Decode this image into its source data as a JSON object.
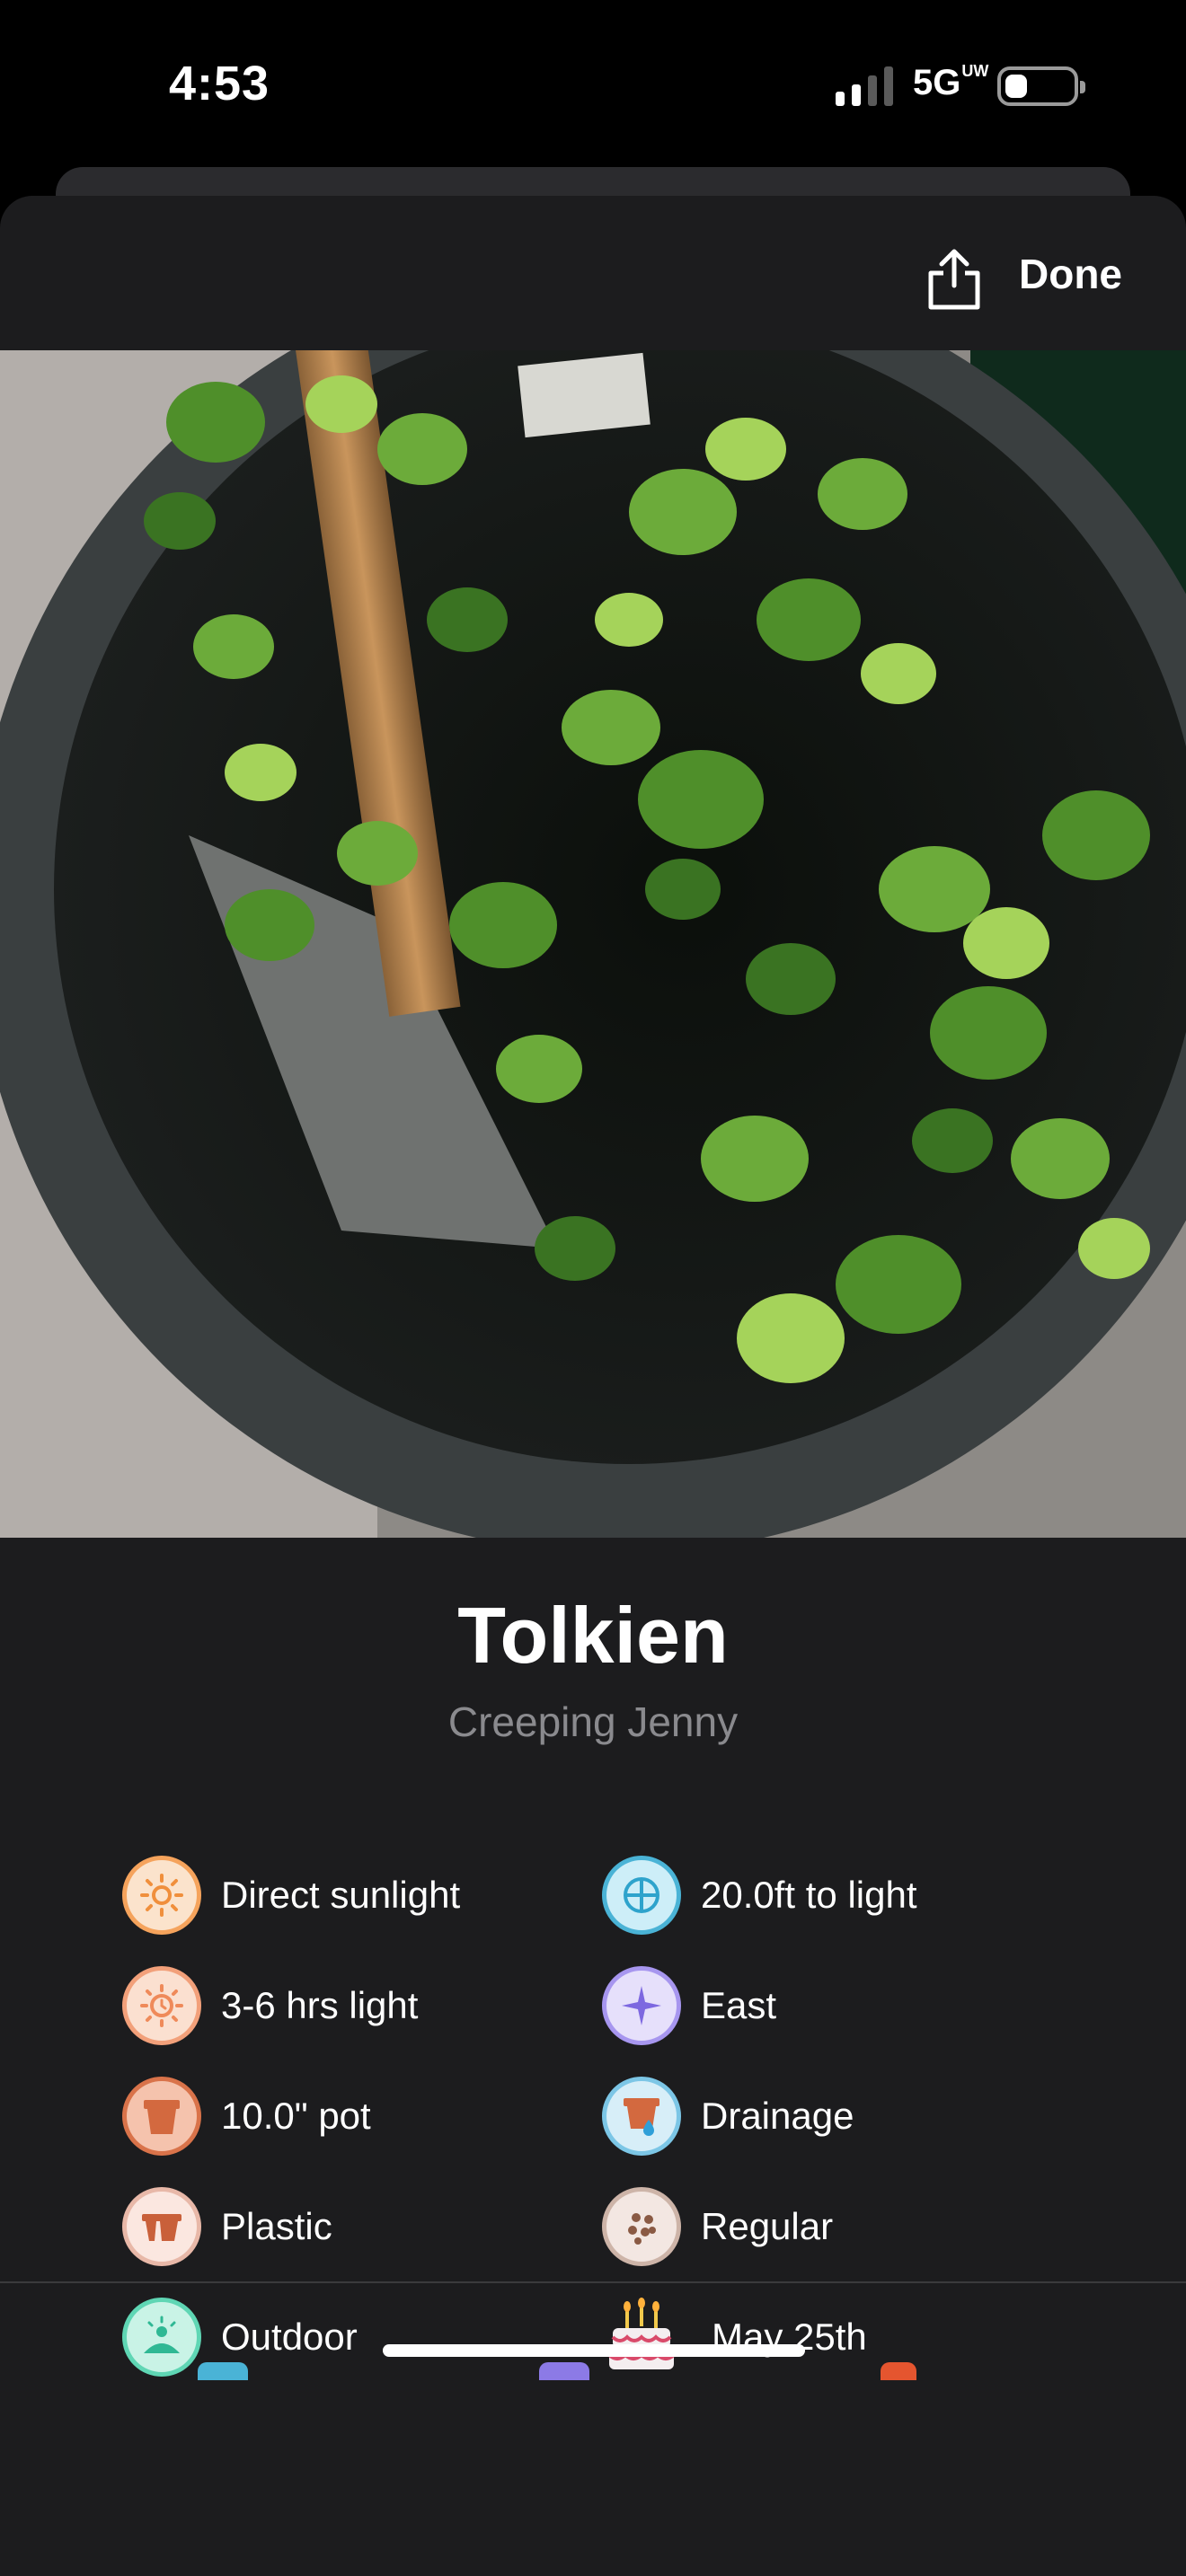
{
  "status_bar": {
    "time": "4:53",
    "network": "5G",
    "network_sup": "UW"
  },
  "header": {
    "done_label": "Done"
  },
  "plant": {
    "name": "Tolkien",
    "species": "Creeping Jenny"
  },
  "attributes_left": [
    {
      "icon": "sun-icon",
      "label": "Direct sunlight"
    },
    {
      "icon": "sun-clock-icon",
      "label": "3-6 hrs light"
    },
    {
      "icon": "pot-icon",
      "label": "10.0\" pot"
    },
    {
      "icon": "plastic-pot-icon",
      "label": "Plastic"
    },
    {
      "icon": "outdoor-icon",
      "label": "Outdoor"
    }
  ],
  "attributes_right": [
    {
      "icon": "window-icon",
      "label": "20.0ft to light"
    },
    {
      "icon": "compass-star-icon",
      "label": "East"
    },
    {
      "icon": "drainage-pot-icon",
      "label": "Drainage"
    },
    {
      "icon": "soil-icon",
      "label": "Regular"
    },
    {
      "icon": "birthday-cake-icon",
      "label": "May 25th"
    }
  ],
  "colors": {
    "background": "#1c1c1e",
    "sun": "#f5a35c",
    "pot": "#d9734a",
    "window": "#4ab3d6",
    "compass": "#8c7ae6",
    "outdoor": "#3cc9a6"
  }
}
